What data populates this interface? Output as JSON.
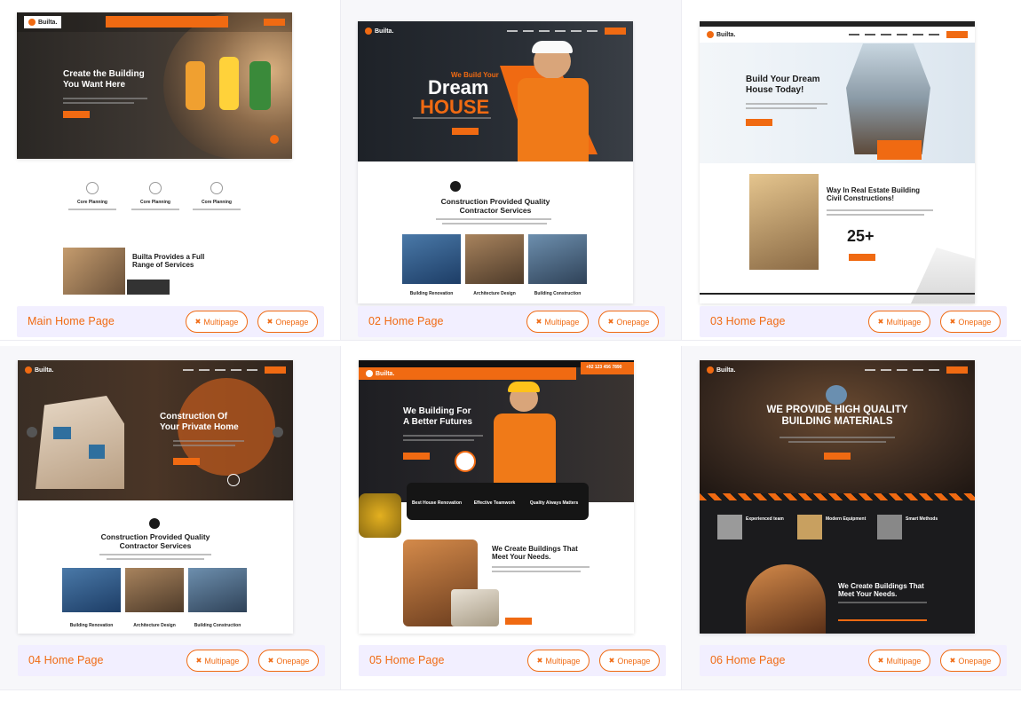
{
  "pages": [
    {
      "title": "Main Home Page",
      "multipage_label": "Multipage",
      "onepage_label": "Onepage",
      "hero": "Create the Building\nYou Want Here",
      "logo": "Builta.",
      "features": [
        "Core Planning",
        "Core Planning",
        "Core Planning"
      ],
      "section": "Builta Provides a Full\nRange of Services"
    },
    {
      "title": "02 Home Page",
      "multipage_label": "Multipage",
      "onepage_label": "Onepage",
      "hero_small": "We Build Your",
      "hero_big1": "Dream",
      "hero_big2": "HOUSE",
      "logo": "Builta.",
      "section": "Construction Provided Quality\nContractor Services",
      "cards": [
        "Building Renovation",
        "Architecture Design",
        "Building Construction"
      ]
    },
    {
      "title": "03 Home Page",
      "multipage_label": "Multipage",
      "onepage_label": "Onepage",
      "hero": "Build Your Dream\nHouse Today!",
      "logo": "Builta.",
      "section": "Way In Real Estate Building\nCivil Constructions!",
      "years": "25+"
    },
    {
      "title": "04 Home Page",
      "multipage_label": "Multipage",
      "onepage_label": "Onepage",
      "hero": "Construction Of\nYour Private Home",
      "logo": "Builta.",
      "section": "Construction Provided Quality\nContractor Services",
      "cards": [
        "Building Renovation",
        "Architecture Design",
        "Building Construction"
      ]
    },
    {
      "title": "05 Home Page",
      "multipage_label": "Multipage",
      "onepage_label": "Onepage",
      "hero": "We Building For\nA Better Futures",
      "logo": "Builta.",
      "phone": "+92 123 456 7890",
      "bar": [
        "Best House Renovation",
        "Effective Teamwork",
        "Quality Always Matters"
      ],
      "section": "We Create Buildings That\nMeet Your Needs."
    },
    {
      "title": "06 Home Page",
      "multipage_label": "Multipage",
      "onepage_label": "Onepage",
      "hero": "WE PROVIDE HIGH QUALITY\nBUILDING MATERIALS",
      "logo": "Builta.",
      "feats": [
        "Experienced team",
        "Modern Equipment",
        "Smart Methods"
      ],
      "section": "We Create Buildings That\nMeet Your Needs."
    }
  ],
  "colors": {
    "accent": "#f06a12",
    "footer_bg": "#f2efff"
  }
}
